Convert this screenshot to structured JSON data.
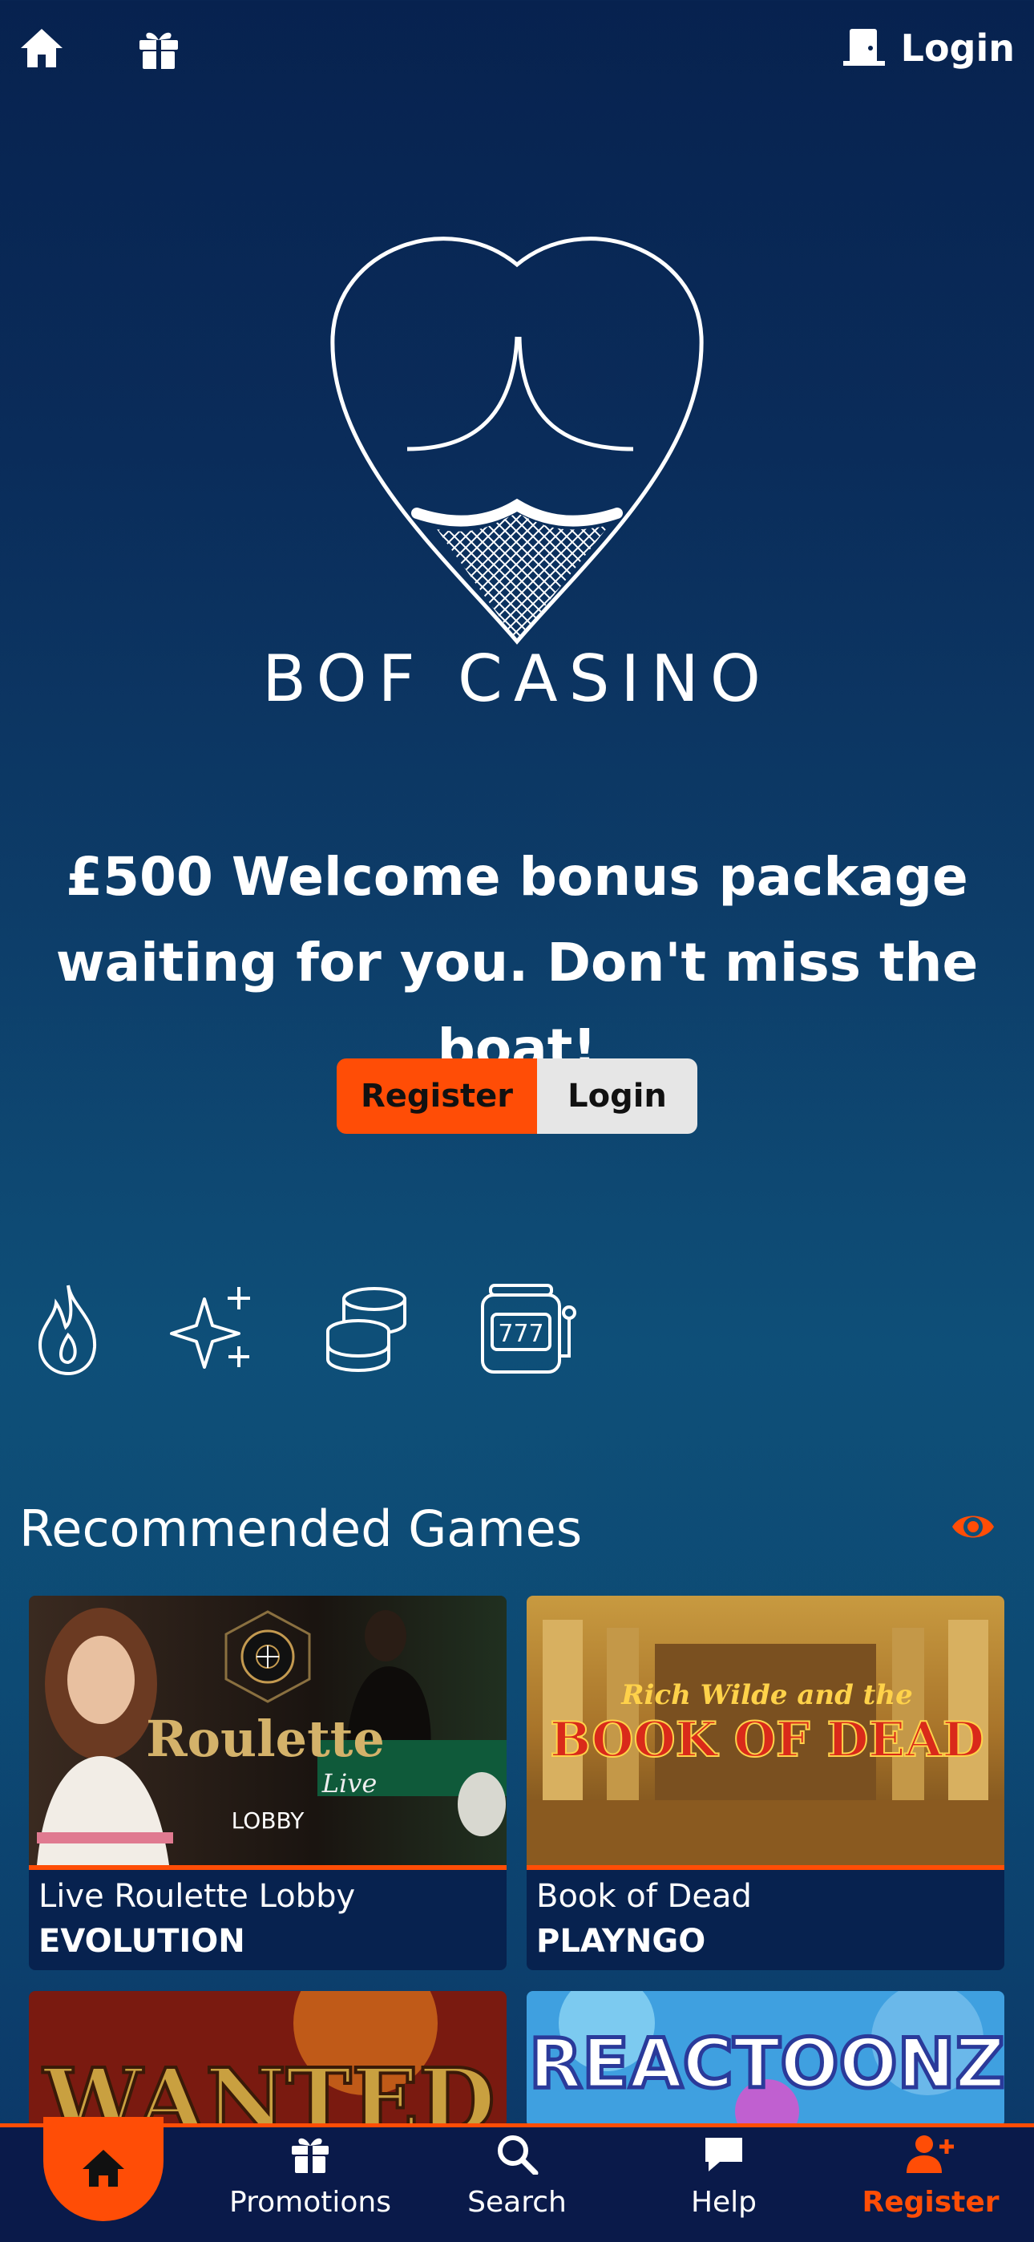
{
  "header": {
    "login_label": "Login"
  },
  "brand": {
    "name": "BOF CASINO"
  },
  "hero": {
    "headline_line1": "£500 Welcome bonus package",
    "headline_line2": "waiting for you. Don't miss the boat!",
    "register_label": "Register",
    "login_label": "Login"
  },
  "categories": [
    "flame-icon",
    "sparkles-icon",
    "coins-icon",
    "slot-machine-icon"
  ],
  "recommended": {
    "title": "Recommended Games",
    "games": [
      {
        "name": "Live Roulette Lobby",
        "provider": "EVOLUTION",
        "thumb_title": "Roulette",
        "thumb_sub": "Live",
        "thumb_tag": "LOBBY"
      },
      {
        "name": "Book of Dead",
        "provider": "PLAYNGO",
        "thumb_title": "BOOK OF DEAD",
        "thumb_sub": "Rich Wilde and the"
      },
      {
        "thumb_title": "WANTED"
      },
      {
        "thumb_title": "REACTOONZ"
      }
    ]
  },
  "bottom_nav": {
    "promotions": "Promotions",
    "search": "Search",
    "help": "Help",
    "register": "Register"
  },
  "colors": {
    "accent": "#ff4d06",
    "navy": "#07224f",
    "teal": "#0e4f78"
  }
}
